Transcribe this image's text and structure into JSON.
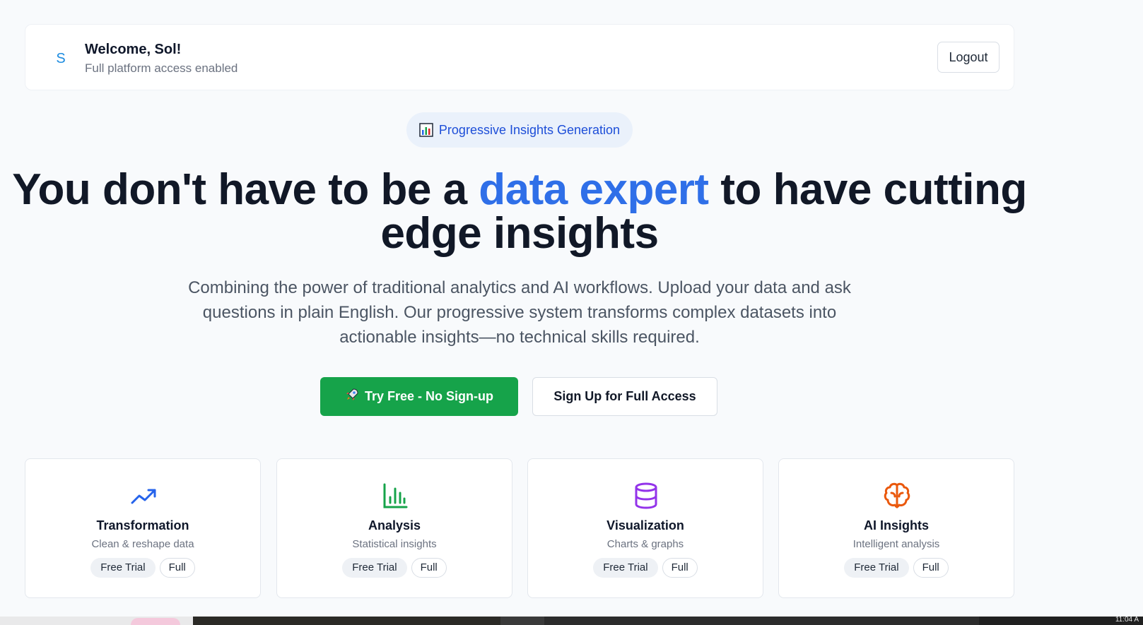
{
  "header": {
    "avatar_letter": "S",
    "welcome": "Welcome, Sol!",
    "subtitle": "Full platform access enabled",
    "logout_label": "Logout"
  },
  "badge": {
    "icon": "bar-chart-icon",
    "label": "Progressive Insights Generation"
  },
  "hero": {
    "headline_before": "You don't have to be a ",
    "headline_accent": "data expert",
    "headline_after": " to have cutting edge insights",
    "subcopy": "Combining the power of traditional analytics and AI workflows. Upload your data and ask questions in plain English. Our progressive system transforms complex datasets into actionable insights—no technical skills required."
  },
  "cta": {
    "primary_icon": "rocket-icon",
    "primary_label": "Try Free - No Sign-up",
    "secondary_label": "Sign Up for Full Access"
  },
  "features": [
    {
      "icon": "trending-up-icon",
      "title": "Transformation",
      "subtitle": "Clean & reshape data",
      "tag_free": "Free Trial",
      "tag_full": "Full",
      "color": "#2563eb"
    },
    {
      "icon": "bar-chart-icon",
      "title": "Analysis",
      "subtitle": "Statistical insights",
      "tag_free": "Free Trial",
      "tag_full": "Full",
      "color": "#16a34a"
    },
    {
      "icon": "database-icon",
      "title": "Visualization",
      "subtitle": "Charts & graphs",
      "tag_free": "Free Trial",
      "tag_full": "Full",
      "color": "#9333ea"
    },
    {
      "icon": "brain-icon",
      "title": "AI Insights",
      "subtitle": "Intelligent analysis",
      "tag_free": "Free Trial",
      "tag_full": "Full",
      "color": "#ea580c"
    }
  ],
  "taskbar": {
    "clock": "11:04 A"
  },
  "colors": {
    "accent_blue": "#2f6fe8",
    "primary_green": "#16a34a",
    "background": "#f8fafc"
  }
}
